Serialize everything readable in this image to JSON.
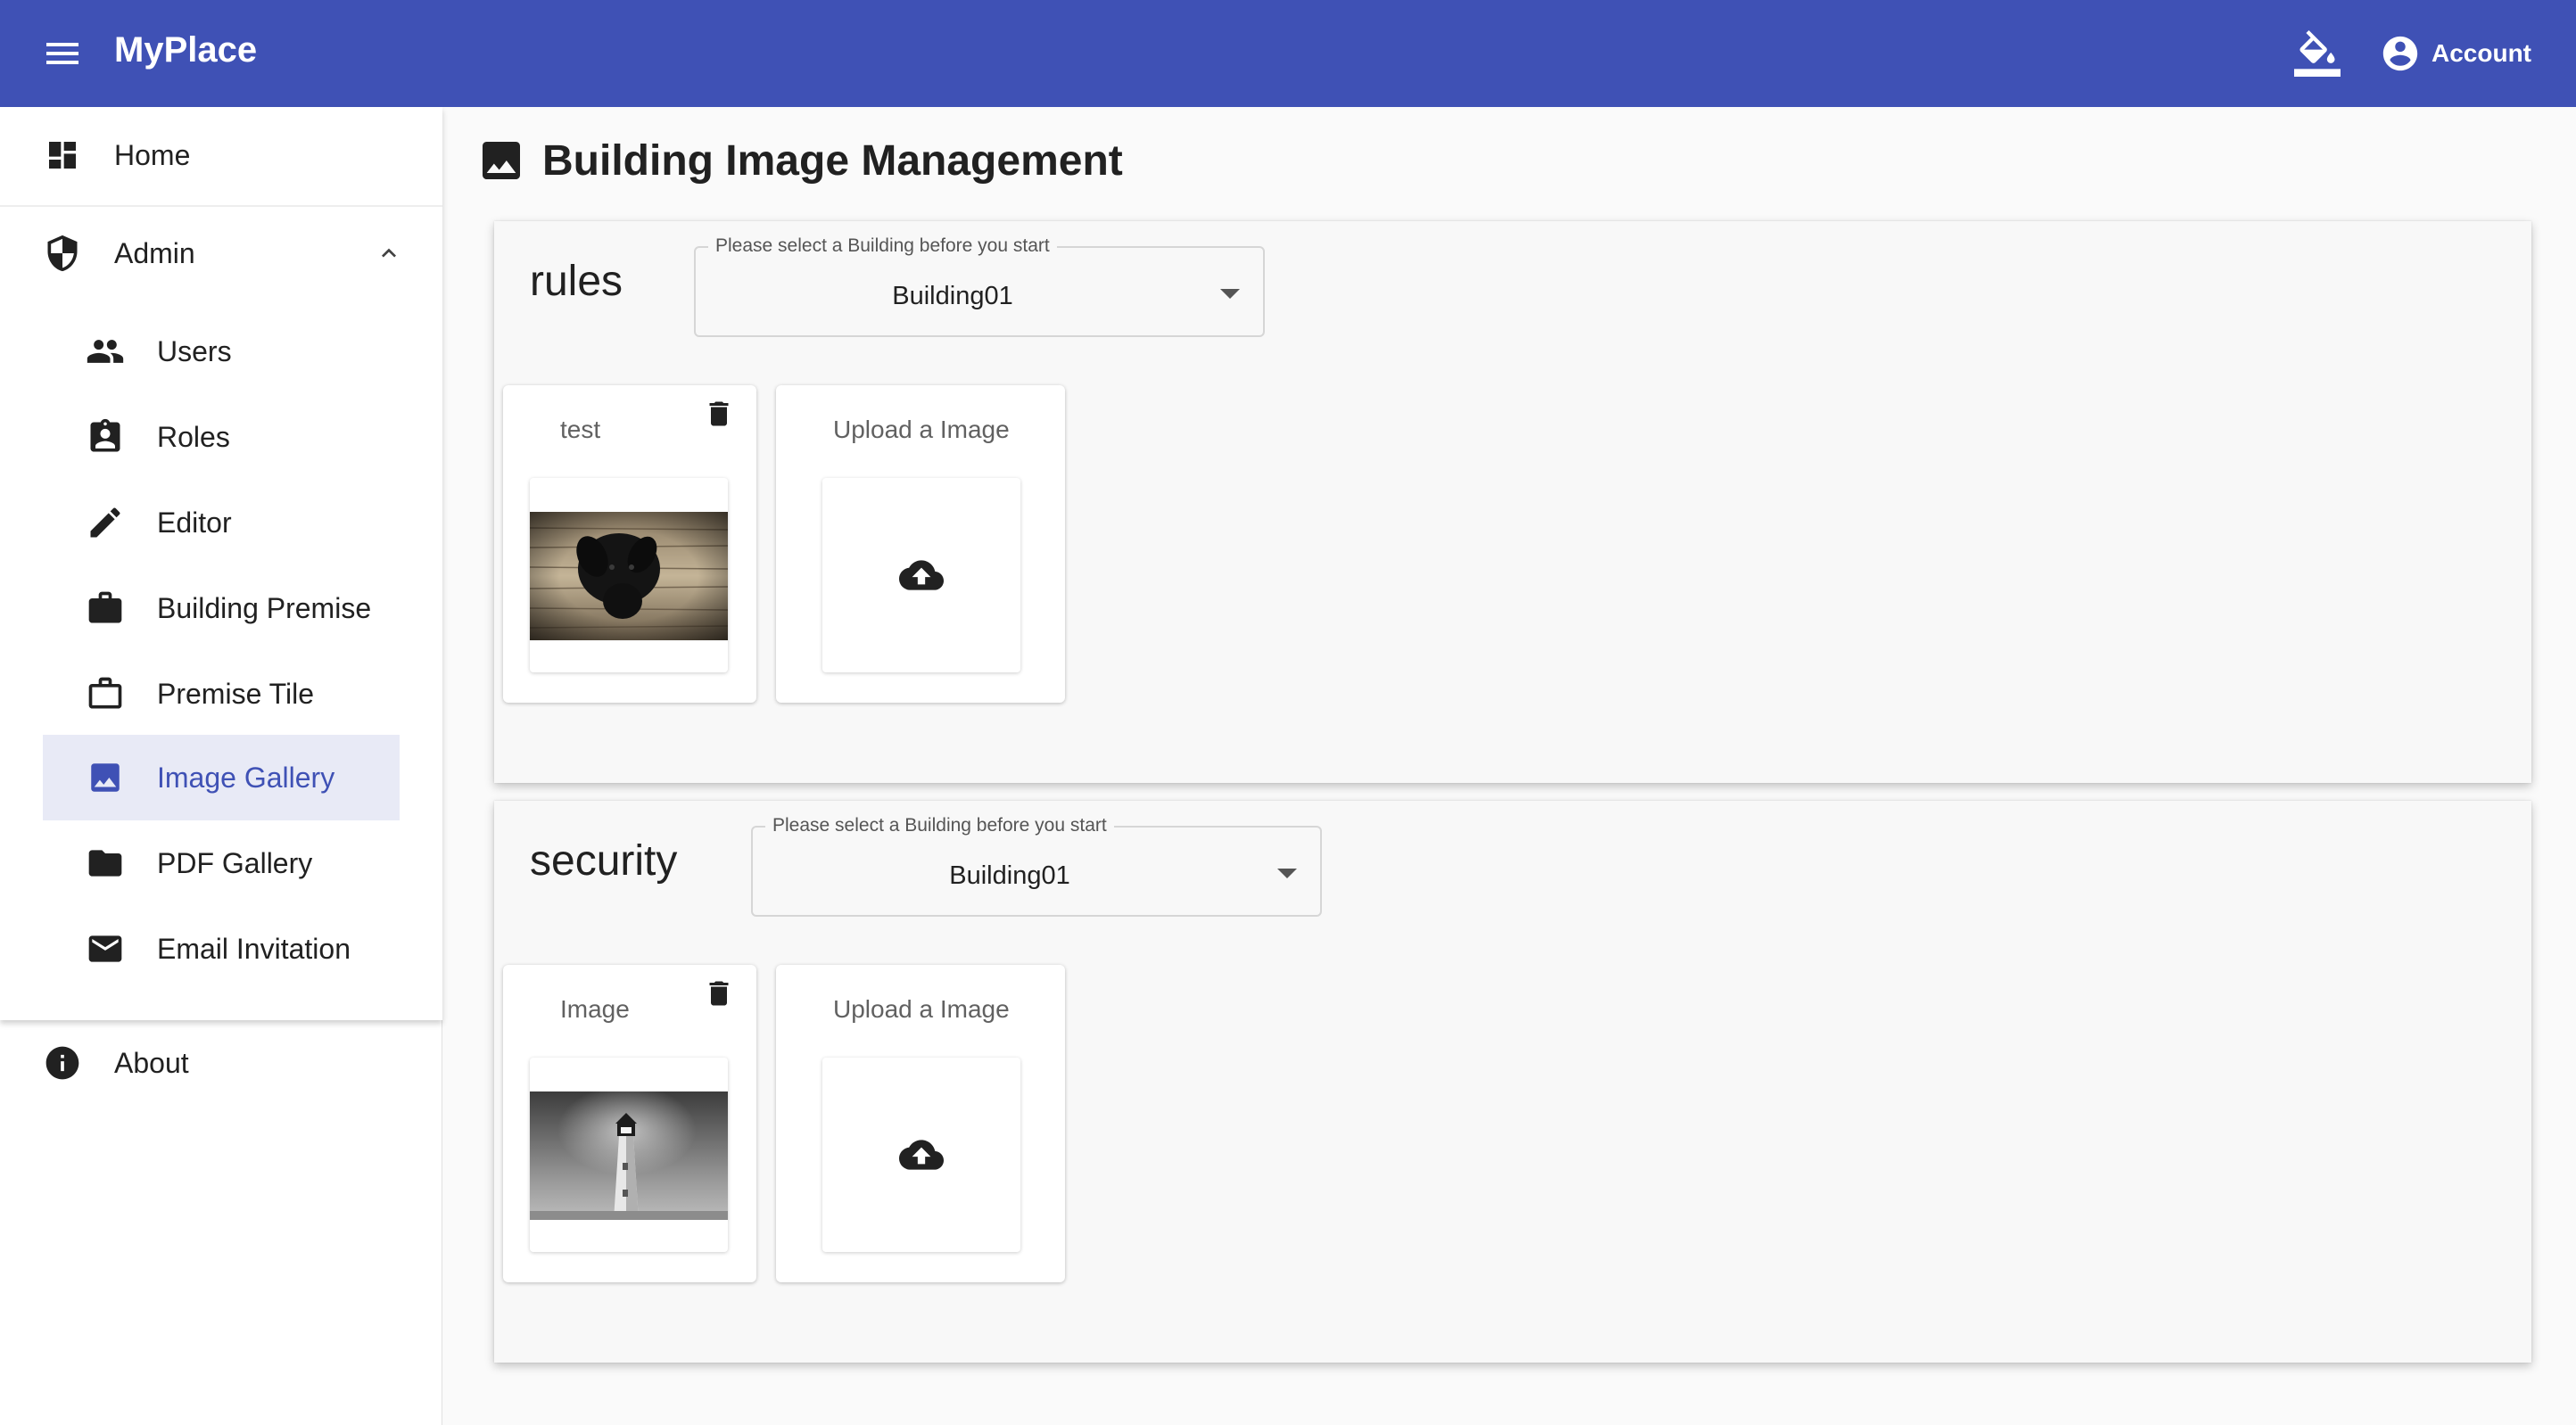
{
  "app": {
    "title": "MyPlace",
    "account_label": "Account"
  },
  "sidebar": {
    "items": [
      {
        "label": "Home",
        "icon": "dashboard-icon"
      },
      {
        "label": "Admin",
        "icon": "shield-icon",
        "expanded": true
      },
      {
        "label": "Users",
        "icon": "people-icon"
      },
      {
        "label": "Roles",
        "icon": "assignment-ind-icon"
      },
      {
        "label": "Editor",
        "icon": "pencil-icon"
      },
      {
        "label": "Building Premise",
        "icon": "briefcase-icon"
      },
      {
        "label": "Premise Tile",
        "icon": "briefcase-outline-icon"
      },
      {
        "label": "Image Gallery",
        "icon": "image-icon",
        "active": true
      },
      {
        "label": "PDF Gallery",
        "icon": "folder-icon"
      },
      {
        "label": "Email Invitation",
        "icon": "mail-icon"
      },
      {
        "label": "About",
        "icon": "info-icon"
      }
    ]
  },
  "main": {
    "page_title": "Building Image Management",
    "sections": [
      {
        "title": "rules",
        "select_label": "Please select a Building before you start",
        "select_value": "Building01",
        "image_card_title": "test",
        "image_subject": "black dog on wooden floor",
        "upload_label": "Upload a Image"
      },
      {
        "title": "security",
        "select_label": "Please select a Building before you start",
        "select_value": "Building01",
        "image_card_title": "Image",
        "image_subject": "lighthouse in grayscale",
        "upload_label": "Upload a Image"
      }
    ]
  },
  "colors": {
    "appbar": "#3f51b5",
    "active_item_bg": "#e8eaf6",
    "active_item_text": "#3f51b5"
  }
}
